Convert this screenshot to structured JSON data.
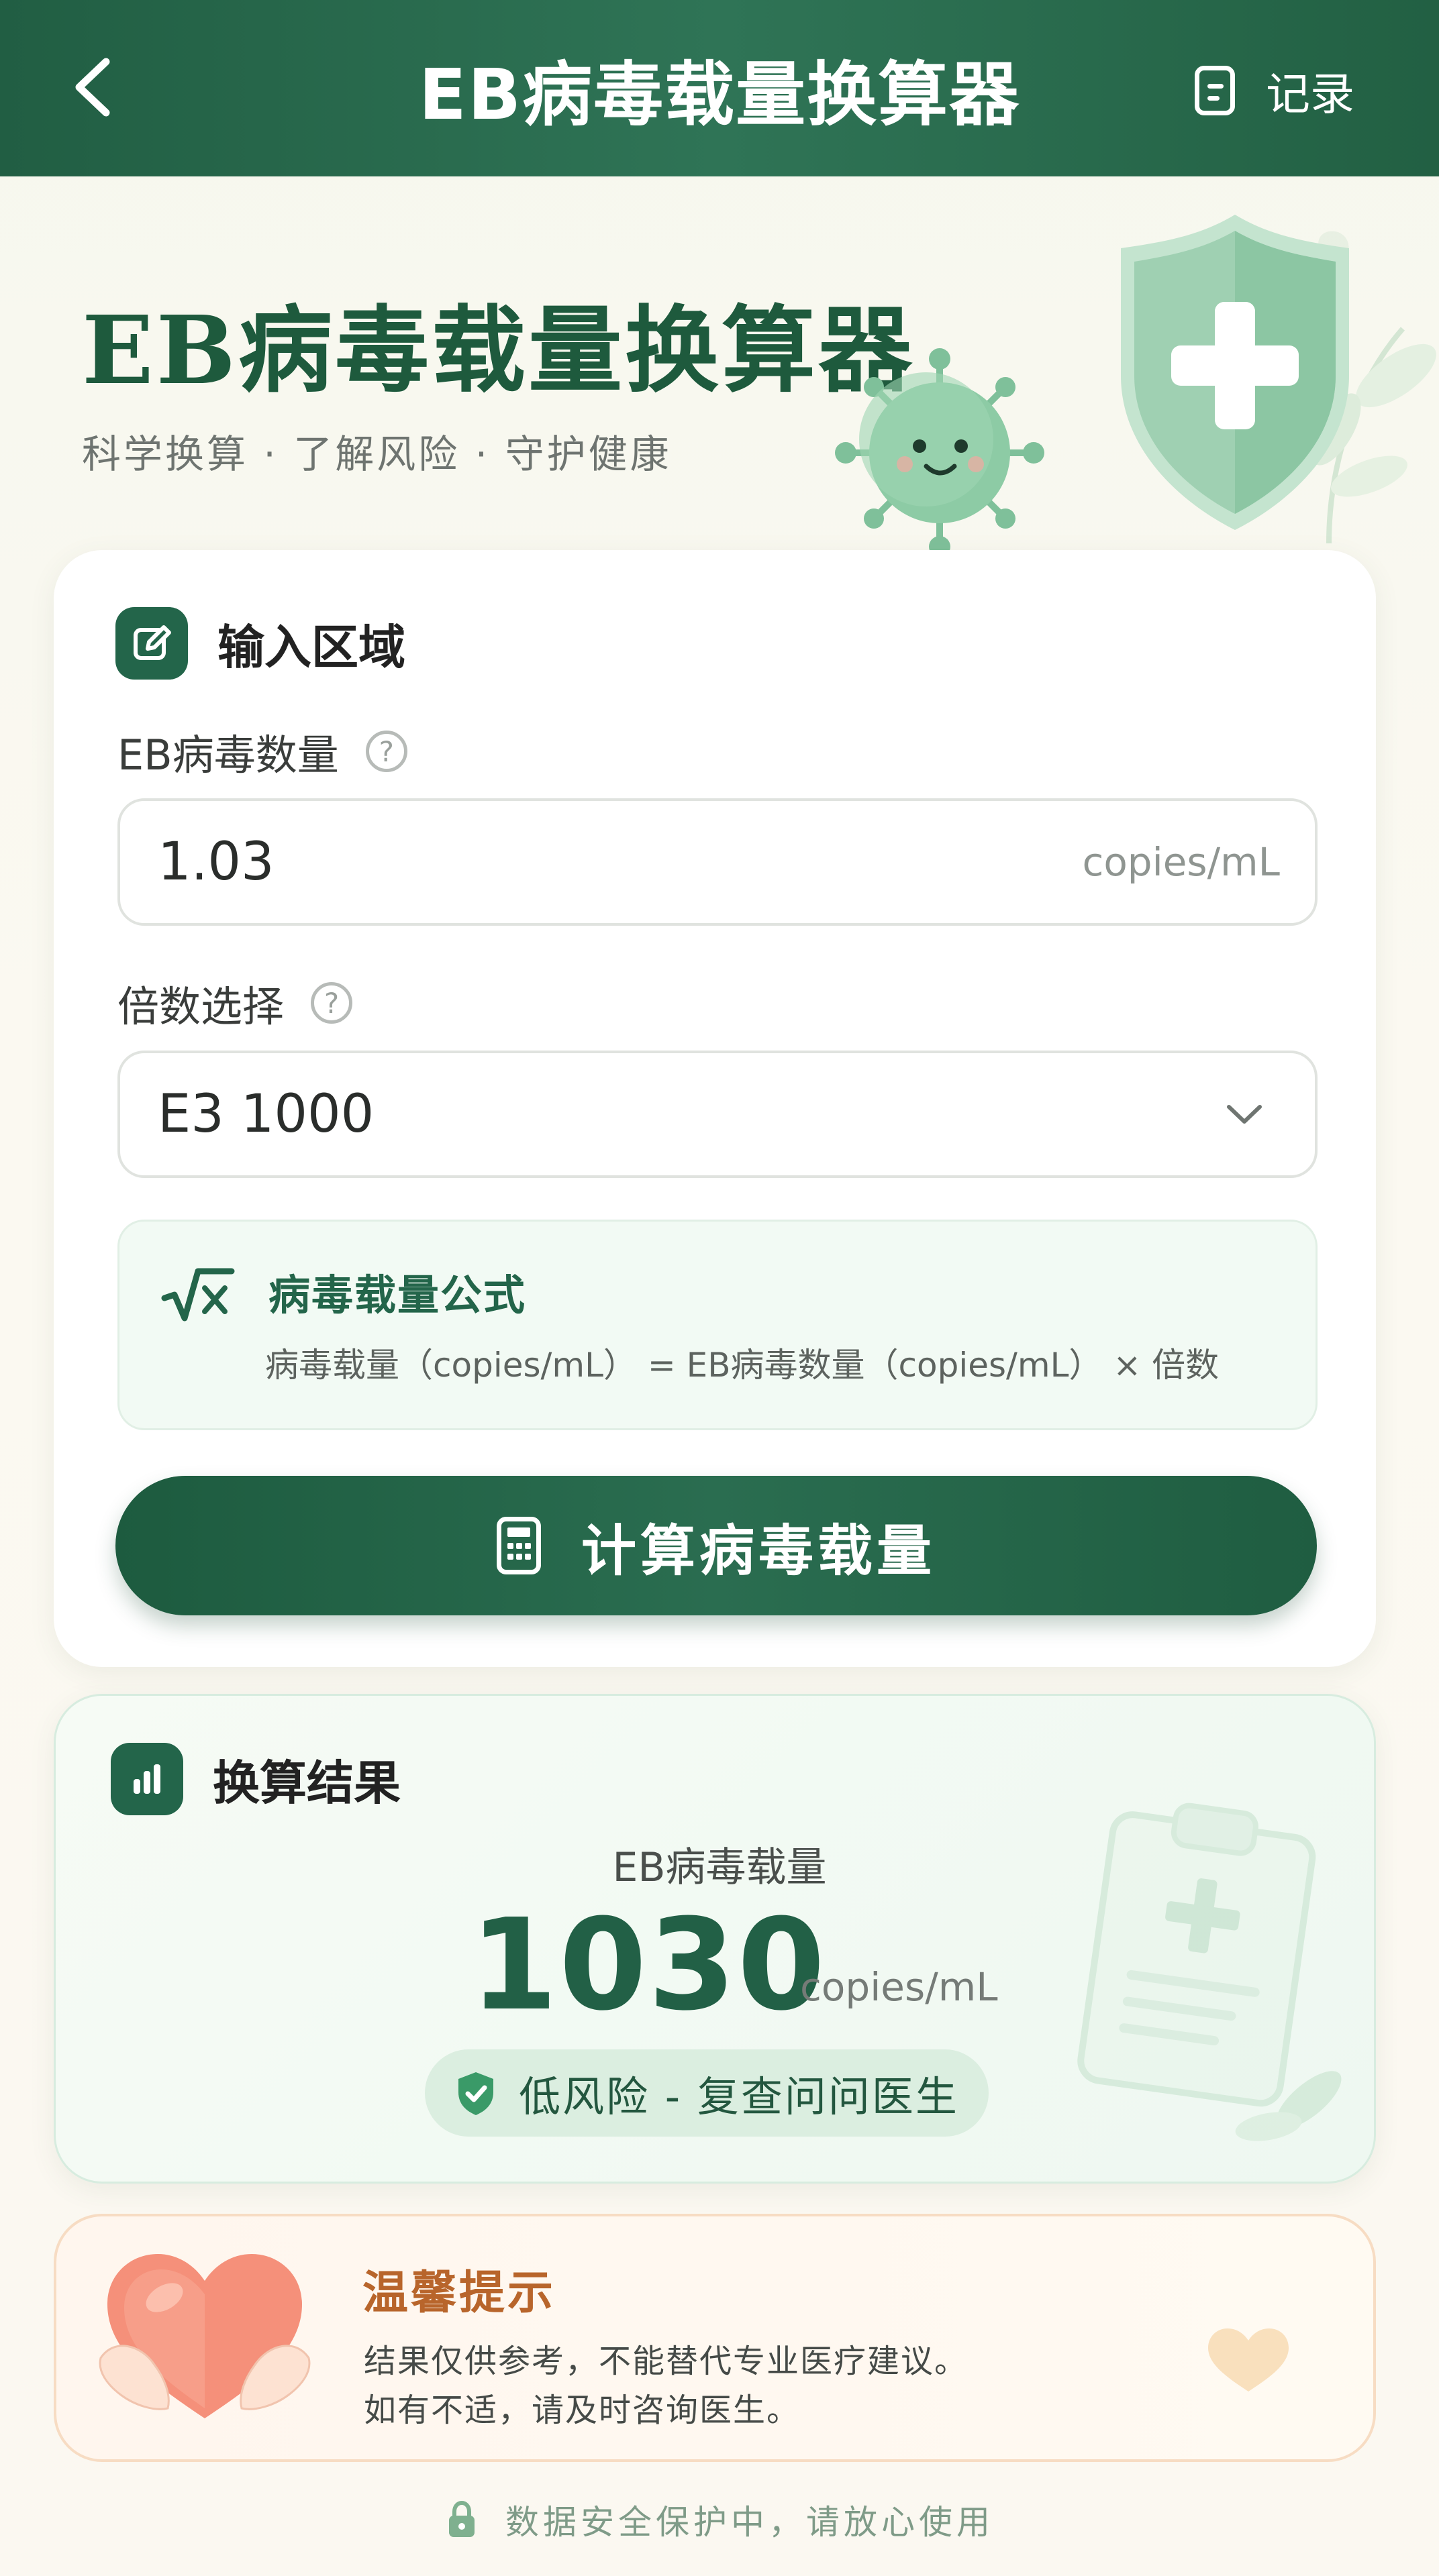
{
  "topbar": {
    "title": "EB病毒载量换算器",
    "records_label": "记录"
  },
  "hero": {
    "title": "EB病毒载量换算器",
    "subtitle": "科学换算 · 了解风险 · 守护健康"
  },
  "input_section": {
    "title": "输入区域",
    "count_label": "EB病毒数量",
    "count_value": "1.03",
    "count_unit": "copies/mL",
    "multiplier_label": "倍数选择",
    "multiplier_value": "E3 1000",
    "formula_title": "病毒载量公式",
    "formula_text": "病毒载量（copies/mL） = EB病毒数量（copies/mL） × 倍数",
    "calculate_button": "计算病毒载量"
  },
  "result_section": {
    "title": "换算结果",
    "label": "EB病毒载量",
    "value": "1030",
    "unit": "copies/mL",
    "risk_text": "低风险 - 复查问问医生"
  },
  "tip_section": {
    "title": "温馨提示",
    "line1": "结果仅供参考，不能替代专业医疗建议。",
    "line2": "如有不适，请及时咨询医生。"
  },
  "footer": {
    "text": "数据安全保护中，请放心使用"
  },
  "colors": {
    "primary": "#23654a",
    "accent_orange": "#b8652b",
    "badge_bg": "#dbeee0"
  }
}
